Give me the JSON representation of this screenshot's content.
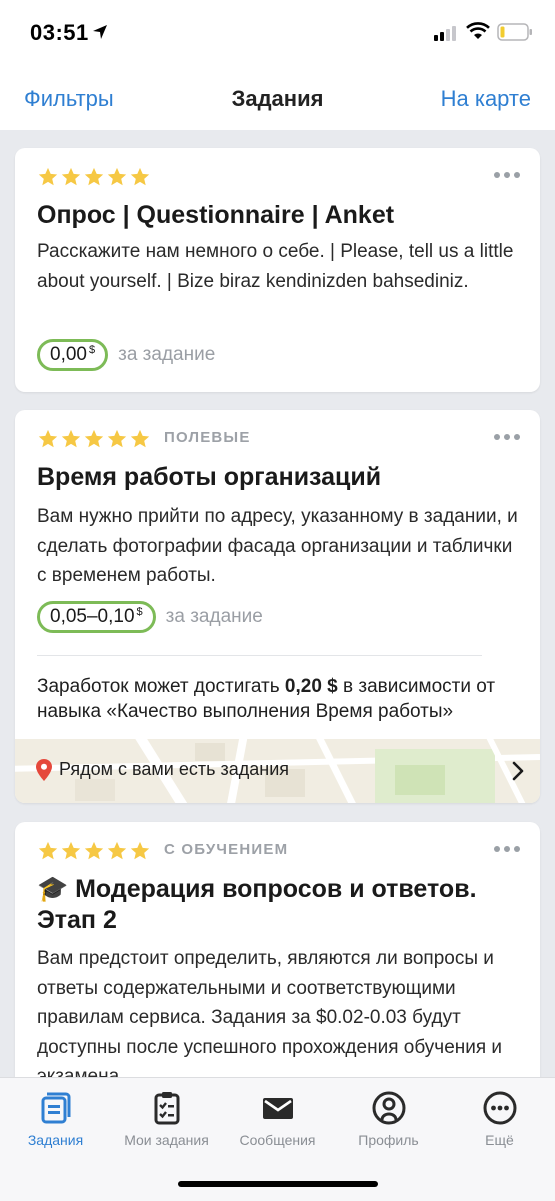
{
  "status_bar": {
    "time": "03:51"
  },
  "nav": {
    "left": "Фильтры",
    "title": "Задания",
    "right": "На карте"
  },
  "colors": {
    "accent": "#2f7fd2",
    "star": "#f6c844",
    "price_border": "#7dbb57"
  },
  "cards": [
    {
      "rating": 5,
      "tag": "",
      "title": "Опрос | Questionnaire | Anket",
      "description": "Расскажите нам немного о себе. | Please, tell us a little about yourself. | Bize biraz kendinizden bahsediniz.",
      "price": "0,00",
      "currency": "$",
      "per_task": "за задание"
    },
    {
      "rating": 5,
      "tag": "ПОЛЕВЫЕ",
      "title": "Время работы организаций",
      "description": "Вам нужно прийти по адресу, указанному в задании, и сделать фотографии фасада организации и таблички с временем работы.",
      "price": "0,05–0,10",
      "currency": "$",
      "per_task": "за задание",
      "earn_prefix": "Заработок может достигать ",
      "earn_amount": "0,20 $",
      "earn_suffix": " в зависимости от навыка «Качество выполнения Время работы»",
      "map_label": "Рядом с вами есть задания"
    },
    {
      "rating": 5,
      "tag": "С ОБУЧЕНИЕМ",
      "title_emoji": "🎓",
      "title": "Модерация вопросов и ответов. Этап 2",
      "description": "Вам предстоит определить, являются ли вопросы и ответы содержательными и соответствующими правилам сервиса. Задания за $0.02-0.03 будут доступны после успешного прохождения обучения и экзамена."
    }
  ],
  "tabs": [
    {
      "label": "Задания",
      "icon": "tasks-icon",
      "active": true
    },
    {
      "label": "Мои задания",
      "icon": "clipboard-check-icon",
      "active": false
    },
    {
      "label": "Сообщения",
      "icon": "envelope-icon",
      "active": false
    },
    {
      "label": "Профиль",
      "icon": "profile-icon",
      "active": false
    },
    {
      "label": "Ещё",
      "icon": "more-dots-icon",
      "active": false
    }
  ]
}
